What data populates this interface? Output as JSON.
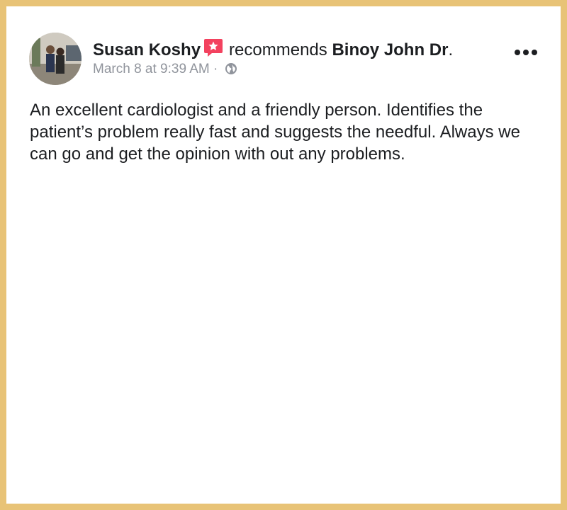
{
  "post": {
    "author": "Susan Koshy",
    "verb": "recommends",
    "target": "Binoy John Dr",
    "target_suffix": ".",
    "timestamp": "March 8 at 9:39 AM",
    "separator": "·",
    "privacy_icon": "globe-icon",
    "badge_icon": "recommendation-star-icon",
    "more_icon": "ellipsis-icon",
    "text": "An excellent cardiologist and a friendly person. Identifies the patient’s problem really fast and suggests the needful. Always we can go and get the opinion with out any problems."
  },
  "colors": {
    "frame": "#e8c377",
    "card": "#ffffff",
    "text": "#1c1e21",
    "meta": "#90949c",
    "badge": "#f3425f"
  }
}
